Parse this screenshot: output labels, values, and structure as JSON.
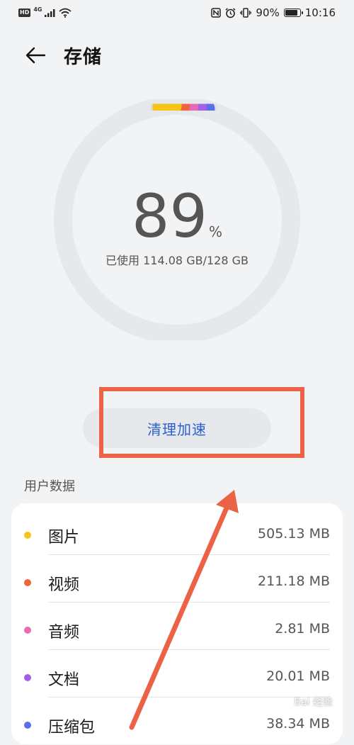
{
  "status_bar": {
    "hd": "HD",
    "network": "4G",
    "battery": "90%",
    "battery_level": 0.9,
    "time": "10:16"
  },
  "header": {
    "title": "存储",
    "back_icon": "arrow-left-icon"
  },
  "storage": {
    "percent": "89",
    "percent_sign": "%",
    "used_text": "已使用 114.08 GB/128 GB",
    "used_fraction": 0.89
  },
  "clean_button": {
    "label": "清理加速"
  },
  "section": {
    "title": "用户数据"
  },
  "user_data": [
    {
      "label": "图片",
      "size": "505.13 MB",
      "color": "#f5c518"
    },
    {
      "label": "视频",
      "size": "211.18 MB",
      "color": "#f0643c"
    },
    {
      "label": "音频",
      "size": "2.81 MB",
      "color": "#e86bb4"
    },
    {
      "label": "文档",
      "size": "20.01 MB",
      "color": "#a25ee8"
    },
    {
      "label": "压缩包",
      "size": "38.34 MB",
      "color": "#5b6ee8"
    }
  ],
  "colors": {
    "accent": "#2a5fd1",
    "annotation": "#ec6246",
    "ring_track": "#e6e8eb"
  }
}
